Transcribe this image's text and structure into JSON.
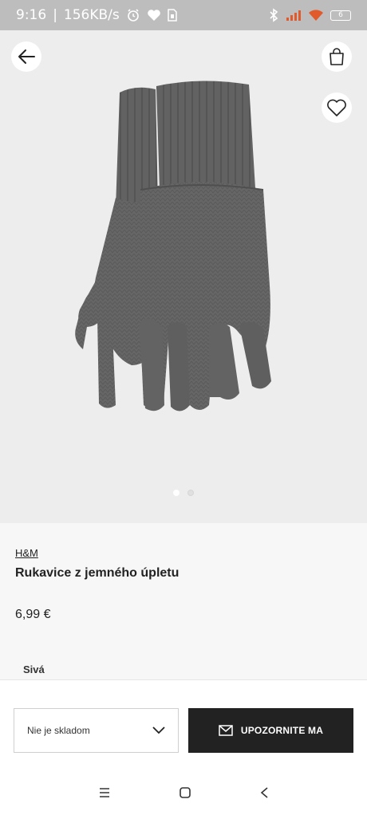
{
  "status_bar": {
    "time": "9:16",
    "speed": "156KB/s",
    "battery": "6"
  },
  "product": {
    "brand": "H&M",
    "title": "Rukavice z jemného úpletu",
    "price": "6,99 €",
    "color": "Sivá"
  },
  "actions": {
    "size_select_label": "Nie je skladom",
    "notify_label": "UPOZORNITE MA"
  },
  "gallery": {
    "current_image": 1,
    "image_count": 2
  },
  "colors": {
    "status_bar": "#bdbdbd",
    "notify_button": "#222222",
    "glove": "#666666"
  },
  "icons": {
    "back": "arrow-left-icon",
    "bag": "shopping-bag-icon",
    "favorite": "heart-icon",
    "select": "chevron-down-icon",
    "notify": "envelope-icon"
  }
}
